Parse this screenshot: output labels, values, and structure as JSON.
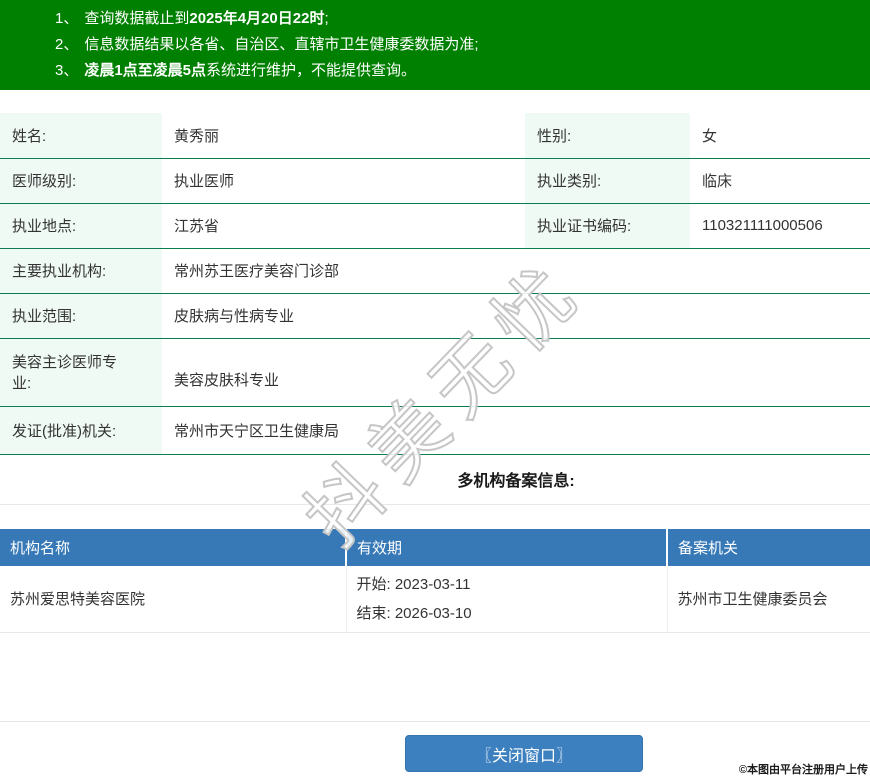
{
  "notice": {
    "items": [
      {
        "num": "1、",
        "pre": "查询数据截止到",
        "bold": "2025年4月20日22时",
        "post": ";"
      },
      {
        "num": "2、",
        "pre": "信息数据结果以各省、自治区、直辖市卫生健康委数据为准;",
        "bold": "",
        "post": ""
      },
      {
        "num": "3、",
        "pre": "",
        "bold": "凌晨1点至凌晨5点",
        "post": "系统进行维护，不能提供查询。"
      }
    ]
  },
  "profile": {
    "name_label": "姓名:",
    "name_value": "黄秀丽",
    "gender_label": "性别:",
    "gender_value": "女",
    "level_label": "医师级别:",
    "level_value": "执业医师",
    "category_label": "执业类别:",
    "category_value": "临床",
    "location_label": "执业地点:",
    "location_value": "江苏省",
    "cert_label": "执业证书编码:",
    "cert_value": "110321111000506",
    "org_label": "主要执业机构:",
    "org_value": "常州苏王医疗美容门诊部",
    "scope_label": "执业范围:",
    "scope_value": "皮肤病与性病专业",
    "cosmetic_label": "美容主诊医师专业:",
    "cosmetic_value": "美容皮肤科专业",
    "issuer_label": "发证(批准)机关:",
    "issuer_value": "常州市天宁区卫生健康局"
  },
  "multi_org": {
    "heading": "多机构备案信息:",
    "columns": [
      "机构名称",
      "有效期",
      "备案机关"
    ],
    "rows": [
      {
        "name": "苏州爱思特美容医院",
        "start": "开始: 2023-03-11",
        "end": "结束: 2026-03-10",
        "authority": "苏州市卫生健康委员会"
      }
    ]
  },
  "footer": {
    "close_button": "〖关闭窗口〗",
    "copyright": "©本图由平台注册用户上传"
  },
  "watermark": {
    "text": "抖美无忧"
  },
  "colors": {
    "banner_green": "#008000",
    "row_border_green": "#0b7d4f",
    "label_bg_mint": "#effaf4",
    "table_header_blue": "#3779b7",
    "button_blue": "#3c80c0"
  }
}
